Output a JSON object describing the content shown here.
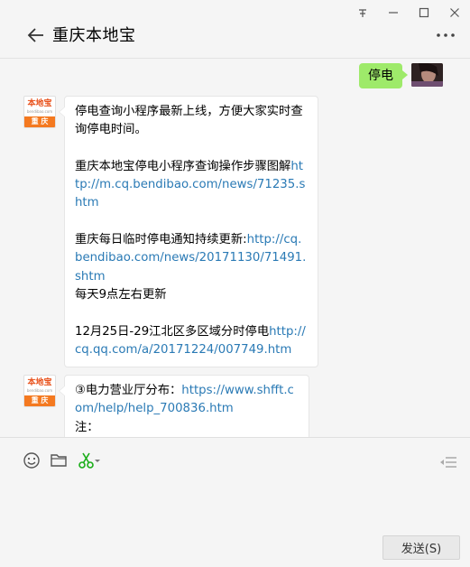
{
  "window": {
    "controls": [
      "pin-icon",
      "minimize-icon",
      "maximize-icon",
      "close-icon"
    ]
  },
  "header": {
    "title": "重庆本地宝"
  },
  "messages": {
    "sent": {
      "text": "停电"
    },
    "bot_avatar": {
      "logo_top": "本地宝",
      "logo_mid": "bendibao.com",
      "logo_bar": "重 庆"
    },
    "msg1": {
      "l1": "停电查询小程序最新上线，方便大家实时查询停电时间。",
      "l2_text": "重庆本地宝停电小程序查询操作步骤图解",
      "l2_link": "http://m.cq.bendibao.com/news/71235.shtm",
      "l3_text": "重庆每日临时停电通知持续更新:",
      "l3_link": "http://cq.bendibao.com/news/20171130/71491.shtm",
      "l4": "每天9点左右更新",
      "l5_text": "12月25日-29江北区多区域分时停电",
      "l5_link": "http://cq.qq.com/a/20171224/007749.htm"
    },
    "msg2": {
      "l1_text": "③电力营业厅分布：",
      "l1_link": "https://www.shfft.com/help/help_700836.htm",
      "l2": "注："
    }
  },
  "toolbar": {
    "icons": [
      "emoji-icon",
      "folder-icon",
      "scissors-icon",
      "chat-history-icon"
    ],
    "send_label": "发送(S)"
  },
  "colors": {
    "link": "#2a7ab5",
    "sent_bubble": "#9eea6a",
    "scissors": "#1aad19",
    "logo_orange": "#f47920"
  }
}
